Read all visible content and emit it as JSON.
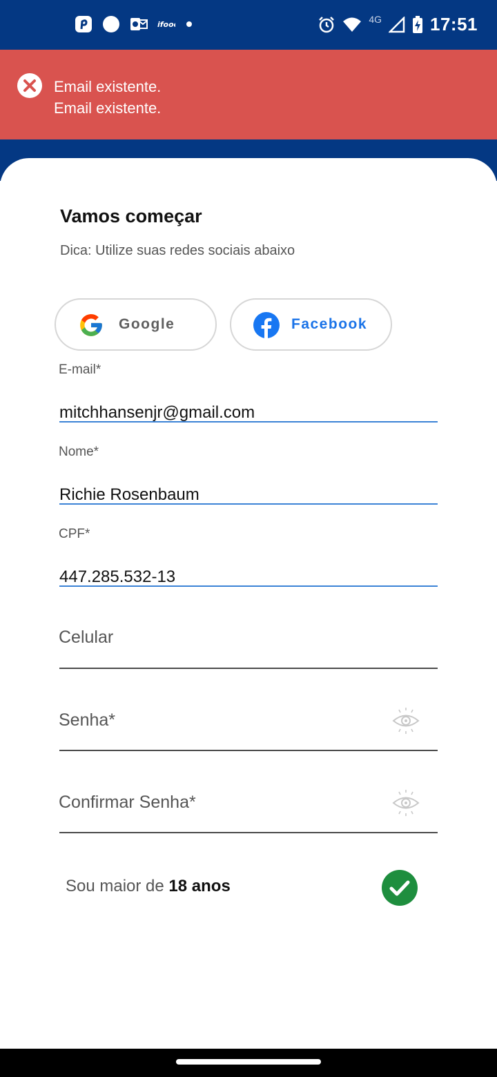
{
  "status_bar": {
    "time": "17:51",
    "network": "4G",
    "left_icons": [
      "pinterest-icon",
      "circle-icon",
      "outlook-icon",
      "ifood-icon",
      "dot-icon"
    ],
    "right_icons": [
      "alarm-icon",
      "wifi-icon",
      "signal-icon",
      "battery-charging-icon"
    ]
  },
  "error_banner": {
    "lines": [
      "Email existente.",
      "Email existente."
    ],
    "color": "#d9534f"
  },
  "header": {
    "title": "Vamos começar",
    "subtitle": "Dica: Utilize suas redes sociais abaixo"
  },
  "social": {
    "google_label": "Google",
    "facebook_label": "Facebook"
  },
  "form": {
    "email_label": "E-mail*",
    "email_value": "mitchhansenjr@gmail.com",
    "name_label": "Nome*",
    "name_value": "Richie Rosenbaum",
    "cpf_label": "CPF*",
    "cpf_value": "447.285.532-13",
    "phone_placeholder": "Celular",
    "password_placeholder": "Senha*",
    "confirm_password_placeholder": "Confirmar Senha*"
  },
  "age_check": {
    "prefix": "Sou maior de ",
    "bold": "18 anos",
    "checked": true
  },
  "colors": {
    "brand_blue": "#043883",
    "input_blue": "#3b82d6",
    "check_green": "#1e8e3e",
    "facebook_blue": "#1a73e8"
  }
}
